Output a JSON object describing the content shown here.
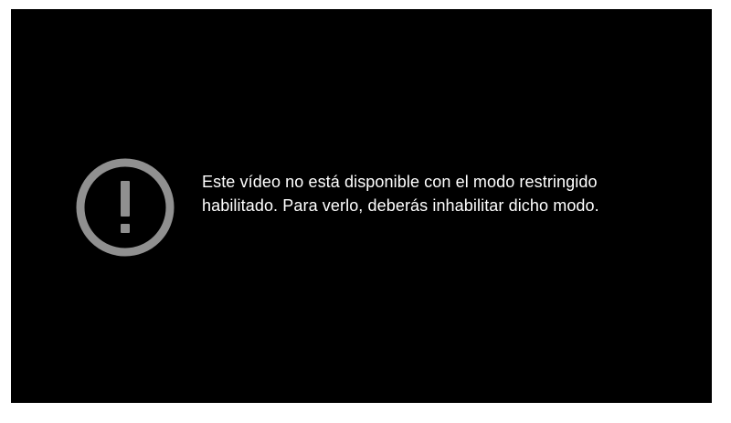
{
  "player": {
    "background_color": "#000000",
    "error": {
      "icon": "exclamation-circle-icon",
      "icon_color": "#909090",
      "message": "Este vídeo no está disponible con el modo restringido habilitado. Para verlo, deberás inhabilitar dicho modo."
    }
  }
}
